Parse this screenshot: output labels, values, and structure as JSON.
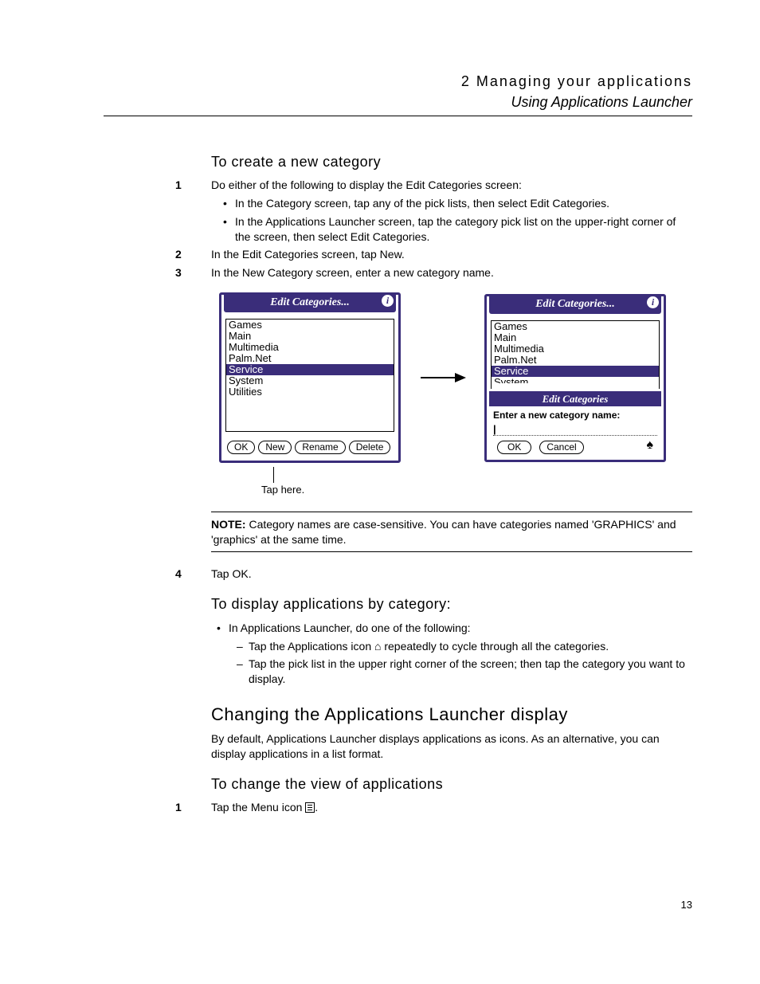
{
  "header": {
    "chapter": "2 Managing your applications",
    "section": "Using Applications Launcher"
  },
  "task1_title": "To create a new category",
  "step1": {
    "num": "1",
    "text": "Do either of the following to display the Edit Categories screen:"
  },
  "step1_bullets": {
    "a": "In the Category screen, tap any of the pick lists, then select Edit Categories.",
    "b": "In the Applications Launcher screen, tap the category pick list on the upper-right corner of the screen, then select Edit Categories."
  },
  "step2": {
    "num": "2",
    "text": "In the Edit Categories screen, tap New."
  },
  "step3": {
    "num": "3",
    "text": "In the New Category screen, enter a new category name."
  },
  "fig": {
    "title1": "Edit Categories...",
    "title2": "Edit Categories...",
    "list": [
      "Games",
      "Main",
      "Multimedia",
      "Palm.Net",
      "Service",
      "System",
      "Utilities"
    ],
    "list2_partial": [
      "Games",
      "Main",
      "Multimedia",
      "Palm.Net",
      "Service",
      "System"
    ],
    "btn_ok": "OK",
    "btn_new": "New",
    "btn_rename": "Rename",
    "btn_delete": "Delete",
    "dialog_title": "Edit Categories",
    "dialog_prompt": "Enter a new category name:",
    "dialog_ok": "OK",
    "dialog_cancel": "Cancel",
    "caption": "Tap here."
  },
  "note": {
    "label": "NOTE:",
    "text": "Category names are case-sensitive. You can have categories named 'GRAPHICS' and 'graphics' at the same time."
  },
  "step4": {
    "num": "4",
    "text": "Tap OK."
  },
  "task2_title": "To display applications by category:",
  "task2_bullet": "In Applications Launcher, do one of the following:",
  "task2_dashes": {
    "a_pre": "Tap the Applications icon ",
    "a_post": " repeatedly to cycle through all the categories.",
    "b": "Tap the pick list in the upper right corner of the screen; then tap the category you want to display."
  },
  "section2_title": "Changing the Applications Launcher display",
  "section2_para": "By default, Applications Launcher displays applications as icons. As an alternative, you can display applications in a list format.",
  "task3_title": "To change the view of applications",
  "task3_step1": {
    "num": "1",
    "text_pre": "Tap the Menu icon ",
    "text_post": "."
  },
  "page_number": "13"
}
